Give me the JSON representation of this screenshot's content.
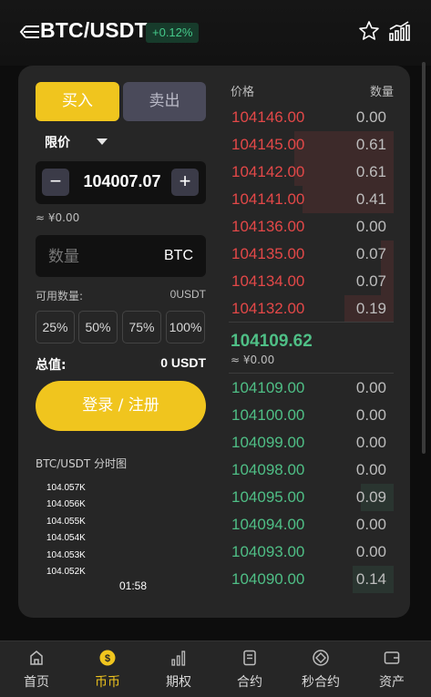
{
  "header": {
    "pair": "BTC/USDT",
    "change": "+0.12%"
  },
  "colors": {
    "accent": "#f0c51e",
    "up": "#4fbf86",
    "down": "#e34848"
  },
  "trade": {
    "buy_label": "买入",
    "sell_label": "卖出",
    "order_type": "限价",
    "price": "104007.07",
    "minus": "−",
    "plus": "+",
    "approx": "≈ ¥0.00",
    "qty_placeholder": "数量",
    "qty_unit": "BTC",
    "available_label": "可用数量:",
    "available_value": "0USDT",
    "percents": [
      "25%",
      "50%",
      "75%",
      "100%"
    ],
    "total_label": "总值:",
    "total_value": "0 USDT",
    "login_label": "登录 / 注册"
  },
  "mini_chart": {
    "title": "BTC/USDT 分时图",
    "ticks": [
      "104.057K",
      "104.056K",
      "104.055K",
      "104.054K",
      "104.053K",
      "104.052K"
    ],
    "time": "01:58"
  },
  "orderbook": {
    "price_header": "价格",
    "qty_header": "数量",
    "asks": [
      {
        "price": "104146.00",
        "qty": "0.00",
        "depth": 0
      },
      {
        "price": "104145.00",
        "qty": "0.61",
        "depth": 0.6
      },
      {
        "price": "104142.00",
        "qty": "0.61",
        "depth": 0.6
      },
      {
        "price": "104141.00",
        "qty": "0.41",
        "depth": 0.55
      },
      {
        "price": "104136.00",
        "qty": "0.00",
        "depth": 0
      },
      {
        "price": "104135.00",
        "qty": "0.07",
        "depth": 0.08
      },
      {
        "price": "104134.00",
        "qty": "0.07",
        "depth": 0.08
      },
      {
        "price": "104132.00",
        "qty": "0.19",
        "depth": 0.3
      }
    ],
    "mid_price": "104109.62",
    "mid_approx": "≈ ¥0.00",
    "bids": [
      {
        "price": "104109.00",
        "qty": "0.00",
        "depth": 0
      },
      {
        "price": "104100.00",
        "qty": "0.00",
        "depth": 0
      },
      {
        "price": "104099.00",
        "qty": "0.00",
        "depth": 0
      },
      {
        "price": "104098.00",
        "qty": "0.00",
        "depth": 0
      },
      {
        "price": "104095.00",
        "qty": "0.09",
        "depth": 0.2
      },
      {
        "price": "104094.00",
        "qty": "0.00",
        "depth": 0
      },
      {
        "price": "104093.00",
        "qty": "0.00",
        "depth": 0
      },
      {
        "price": "104090.00",
        "qty": "0.14",
        "depth": 0.25
      }
    ]
  },
  "nav": {
    "items": [
      {
        "label": "首页",
        "icon": "home-icon"
      },
      {
        "label": "币币",
        "icon": "coin-icon"
      },
      {
        "label": "期权",
        "icon": "options-icon"
      },
      {
        "label": "合约",
        "icon": "contract-icon"
      },
      {
        "label": "秒合约",
        "icon": "second-contract-icon"
      },
      {
        "label": "资产",
        "icon": "wallet-icon"
      }
    ],
    "active": 1
  }
}
